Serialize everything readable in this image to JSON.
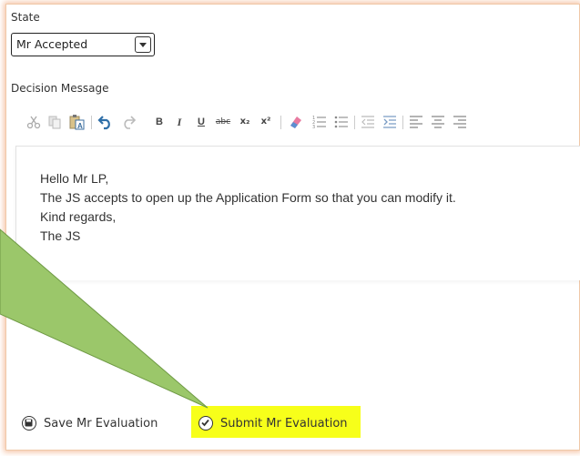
{
  "state": {
    "label": "State",
    "selected": "Mr Accepted"
  },
  "decision": {
    "label": "Decision Message"
  },
  "toolbar": {
    "bold": "B",
    "italic": "I",
    "underline": "U",
    "strike": "abc",
    "subscript": "x₂",
    "superscript": "x²"
  },
  "message": {
    "lines": [
      "Hello Mr LP,",
      "The JS accepts to open up the Application Form so that you can modify it.",
      "Kind regards,",
      "The JS"
    ]
  },
  "actions": {
    "save": "Save Mr Evaluation",
    "submit": "Submit Mr Evaluation"
  },
  "colors": {
    "highlight": "#f7ff1a",
    "callout_fill": "#9bc76a",
    "panel_glow": "#ec965f",
    "undo_blue": "#2f6fa8"
  },
  "icons": {
    "toolbar": [
      "cut-icon",
      "copy-icon",
      "paste-text-icon",
      "undo-icon",
      "redo-icon",
      "remove-format-icon",
      "numbered-list-icon",
      "bulleted-list-icon",
      "outdent-icon",
      "indent-icon",
      "align-left-icon",
      "align-center-icon",
      "align-right-icon"
    ],
    "save": "save-icon",
    "submit": "check-circle-icon"
  }
}
